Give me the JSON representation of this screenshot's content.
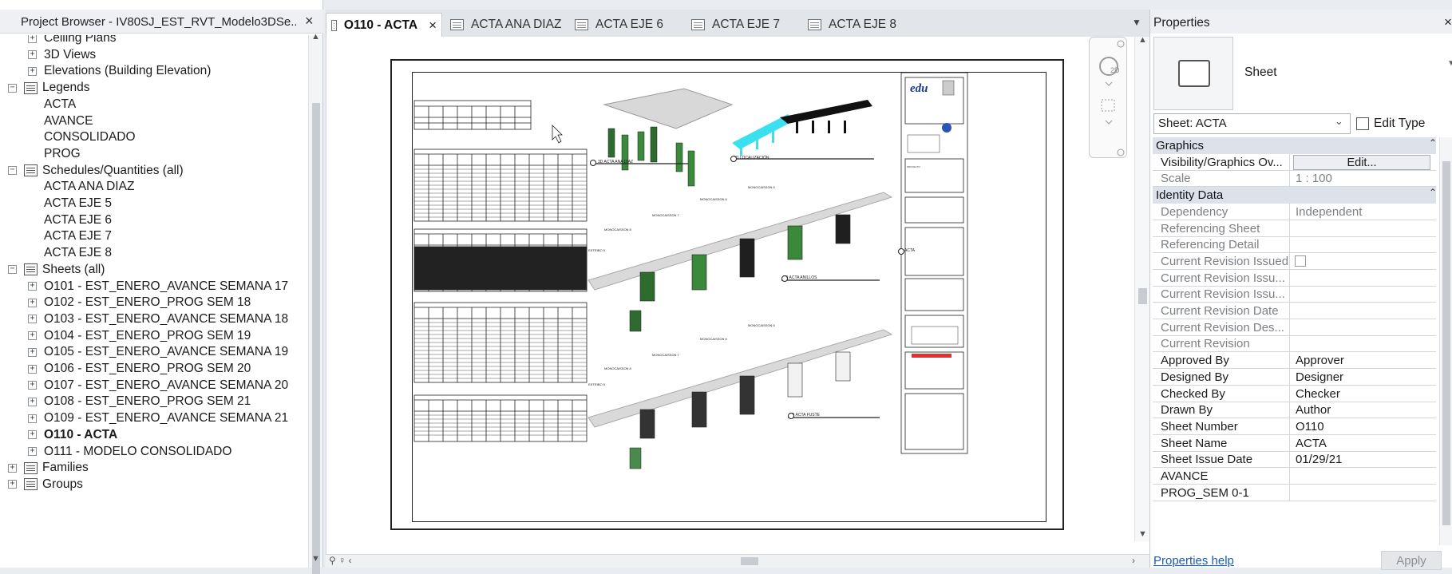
{
  "project_browser": {
    "title": "Project Browser - IV80SJ_EST_RVT_Modelo3DSe...",
    "close": "×",
    "tree": [
      {
        "label": "Ceiling Plans",
        "level": 2,
        "toggle": "+"
      },
      {
        "label": "3D Views",
        "level": 2,
        "toggle": "+"
      },
      {
        "label": "Elevations (Building Elevation)",
        "level": 2,
        "toggle": "+"
      },
      {
        "label": "Legends",
        "level": 1,
        "toggle": "−",
        "icon": "legend-icon"
      },
      {
        "label": "ACTA",
        "level": 2
      },
      {
        "label": "AVANCE",
        "level": 2
      },
      {
        "label": "CONSOLIDADO",
        "level": 2
      },
      {
        "label": "PROG",
        "level": 2
      },
      {
        "label": "Schedules/Quantities (all)",
        "level": 1,
        "toggle": "−",
        "icon": "schedule-icon"
      },
      {
        "label": "ACTA ANA DIAZ",
        "level": 2
      },
      {
        "label": "ACTA EJE 5",
        "level": 2
      },
      {
        "label": "ACTA EJE 6",
        "level": 2
      },
      {
        "label": "ACTA EJE 7",
        "level": 2
      },
      {
        "label": "ACTA EJE 8",
        "level": 2
      },
      {
        "label": "Sheets (all)",
        "level": 1,
        "toggle": "−",
        "icon": "sheet-icon"
      },
      {
        "label": "O101 - EST_ENERO_AVANCE SEMANA 17",
        "level": 2,
        "toggle": "+"
      },
      {
        "label": "O102 - EST_ENERO_PROG SEM 18",
        "level": 2,
        "toggle": "+"
      },
      {
        "label": "O103 - EST_ENERO_AVANCE SEMANA 18",
        "level": 2,
        "toggle": "+"
      },
      {
        "label": "O104 - EST_ENERO_PROG SEM 19",
        "level": 2,
        "toggle": "+"
      },
      {
        "label": "O105 - EST_ENERO_AVANCE SEMANA 19",
        "level": 2,
        "toggle": "+"
      },
      {
        "label": "O106 - EST_ENERO_PROG SEM 20",
        "level": 2,
        "toggle": "+"
      },
      {
        "label": "O107 - EST_ENERO_AVANCE SEMANA 20",
        "level": 2,
        "toggle": "+"
      },
      {
        "label": "O108 - EST_ENERO_PROG SEM 21",
        "level": 2,
        "toggle": "+"
      },
      {
        "label": "O109 - EST_ENERO_AVANCE SEMANA 21",
        "level": 2,
        "toggle": "+"
      },
      {
        "label": "O110 - ACTA",
        "level": 2,
        "toggle": "+",
        "selected": true
      },
      {
        "label": "O111 - MODELO CONSOLIDADO",
        "level": 2,
        "toggle": "+"
      },
      {
        "label": "Families",
        "level": 0,
        "toggle": "+",
        "icon": "families-icon"
      },
      {
        "label": "Groups",
        "level": 0,
        "toggle": "+",
        "icon": "groups-icon"
      }
    ]
  },
  "tabs": [
    {
      "label": "O110 - ACTA",
      "active": true,
      "close": "×"
    },
    {
      "label": "ACTA ANA DIAZ"
    },
    {
      "label": "ACTA EJE 6"
    },
    {
      "label": "ACTA EJE 7"
    },
    {
      "label": "ACTA EJE 8"
    }
  ],
  "sheet": {
    "logo": "edu",
    "view_labels": [
      "3D ACTA ANA DIAZ",
      "3D LOCALIZACIÓN",
      "3D ACTA ANILLOS",
      "3D ACTA FUSTE",
      "ACTA"
    ],
    "caisson_labels": [
      "MONOCAISSON 5",
      "MONOCAISSON 6",
      "MONOCAISSON 7",
      "MONOCAISSON 8",
      "ESTRIBO 5"
    ]
  },
  "properties": {
    "title": "Properties",
    "close": "×",
    "type_name": "Sheet",
    "filter": "Sheet: ACTA",
    "edit_type": "Edit Type",
    "groups": [
      {
        "name": "Graphics",
        "collapse": "⌃",
        "rows": [
          {
            "name": "Visibility/Graphics Ov...",
            "value": "Edit...",
            "kind": "button"
          },
          {
            "name": "Scale",
            "value": "1 : 100",
            "readonly": true
          }
        ]
      },
      {
        "name": "Identity Data",
        "collapse": "⌃",
        "rows": [
          {
            "name": "Dependency",
            "value": "Independent",
            "readonly": true
          },
          {
            "name": "Referencing Sheet",
            "value": "",
            "readonly": true
          },
          {
            "name": "Referencing Detail",
            "value": "",
            "readonly": true
          },
          {
            "name": "Current Revision Issued",
            "value": "",
            "readonly": true,
            "kind": "checkbox"
          },
          {
            "name": "Current Revision Issu...",
            "value": "",
            "readonly": true
          },
          {
            "name": "Current Revision Issu...",
            "value": "",
            "readonly": true
          },
          {
            "name": "Current Revision Date",
            "value": "",
            "readonly": true
          },
          {
            "name": "Current Revision Des...",
            "value": "",
            "readonly": true
          },
          {
            "name": "Current Revision",
            "value": "",
            "readonly": true
          },
          {
            "name": "Approved By",
            "value": "Approver"
          },
          {
            "name": "Designed By",
            "value": "Designer"
          },
          {
            "name": "Checked By",
            "value": "Checker"
          },
          {
            "name": "Drawn By",
            "value": "Author"
          },
          {
            "name": "Sheet Number",
            "value": "O110"
          },
          {
            "name": "Sheet Name",
            "value": "ACTA"
          },
          {
            "name": "Sheet Issue Date",
            "value": "01/29/21"
          },
          {
            "name": "AVANCE",
            "value": ""
          },
          {
            "name": "PROG_SEM 0-1",
            "value": ""
          }
        ]
      }
    ],
    "help": "Properties help",
    "apply": "Apply"
  }
}
